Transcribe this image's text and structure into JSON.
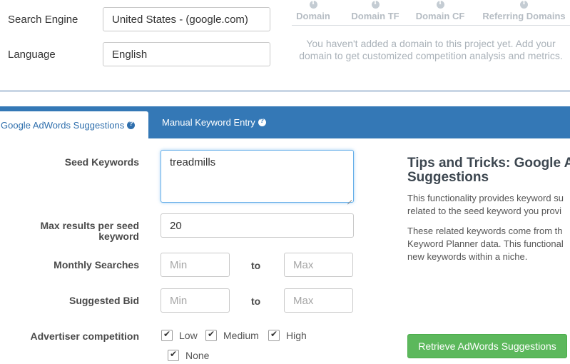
{
  "settings": {
    "search_engine_label": "Search Engine",
    "search_engine_value": "United States - (google.com)",
    "language_label": "Language",
    "language_value": "English"
  },
  "domain_metrics": {
    "columns": [
      "Domain",
      "Domain TF",
      "Domain CF",
      "Referring Domains"
    ],
    "empty_message": "You haven't added a domain to this project yet. Add your domain to get customized competition analysis and metrics."
  },
  "tabs": [
    {
      "label": "Google AdWords Suggestions",
      "active": true,
      "icon": "question-circle-icon"
    },
    {
      "label": "Manual Keyword Entry",
      "active": false,
      "icon": "question-circle-icon"
    }
  ],
  "form": {
    "seed_keywords_label": "Seed Keywords",
    "seed_keywords_value": "treadmills",
    "max_results_label_line1": "Max results per seed",
    "max_results_label_line2": "keyword",
    "max_results_value": "20",
    "monthly_searches_label": "Monthly Searches",
    "suggested_bid_label": "Suggested Bid",
    "min_placeholder": "Min",
    "max_placeholder": "Max",
    "to_label": "to",
    "advertiser_competition_label": "Advertiser competition",
    "competition_options": [
      {
        "label": "Low",
        "checked": true
      },
      {
        "label": "Medium",
        "checked": true
      },
      {
        "label": "High",
        "checked": true
      },
      {
        "label": "None",
        "checked": true
      }
    ]
  },
  "tips": {
    "title_line1": "Tips and Tricks: Google AdW",
    "title_line2": "Suggestions",
    "p1_line1": "This functionality provides keyword su",
    "p1_line2": "related to the seed keyword you provi",
    "p2_line1": "These related keywords come from th",
    "p2_line2": "Keyword Planner data. This functional",
    "p2_line3": "new keywords within a niche.",
    "button_label": "Retrieve AdWords Suggestions"
  },
  "colors": {
    "tab_bar": "#3478b6",
    "active_tab_text": "#2f6fad",
    "button_green": "#5cb85c",
    "focus_blue": "#66afe9"
  }
}
